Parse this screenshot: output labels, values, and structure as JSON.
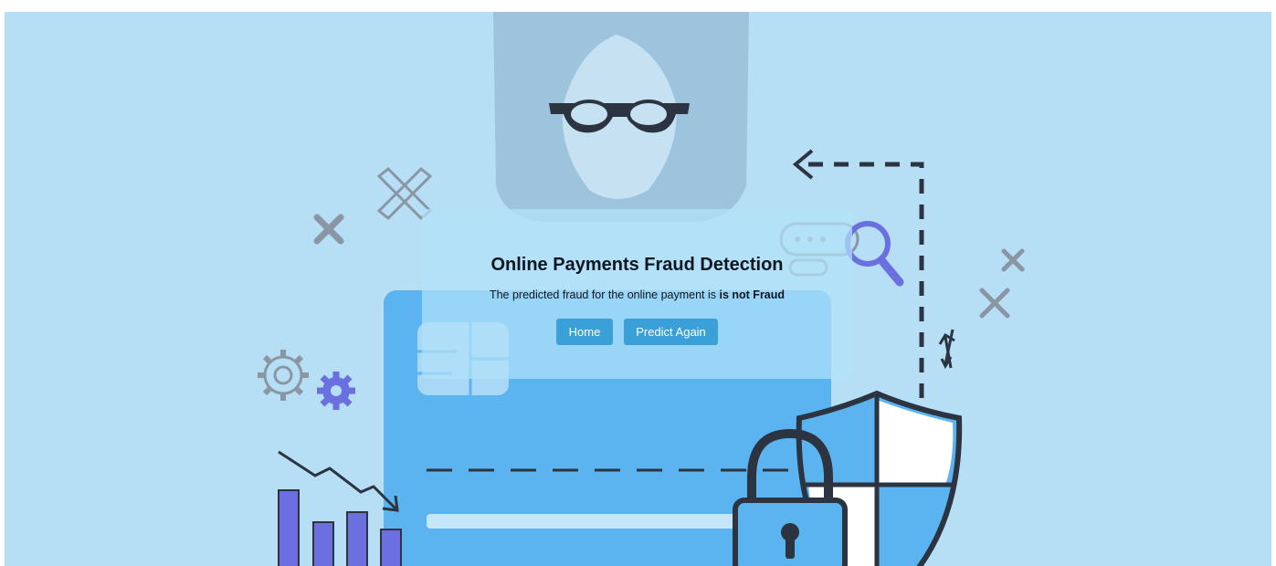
{
  "page": {
    "title": "Online Payments Fraud Detection",
    "result_prefix": "The predicted fraud for the online payment is ",
    "result_value": "is not Fraud"
  },
  "actions": {
    "home_label": "Home",
    "predict_again_label": "Predict Again"
  },
  "illustration": {
    "icons": [
      "person-silhouette-icon",
      "credit-card-icon",
      "padlock-icon",
      "shield-icon",
      "magnifier-icon",
      "gear-icon",
      "bar-chart-icon",
      "close-icon",
      "arrow-icon"
    ]
  },
  "colors": {
    "background": "#b6def5",
    "button": "#3aa0d7",
    "card": "#5bb4ef",
    "bars": "#6b6fe0"
  }
}
